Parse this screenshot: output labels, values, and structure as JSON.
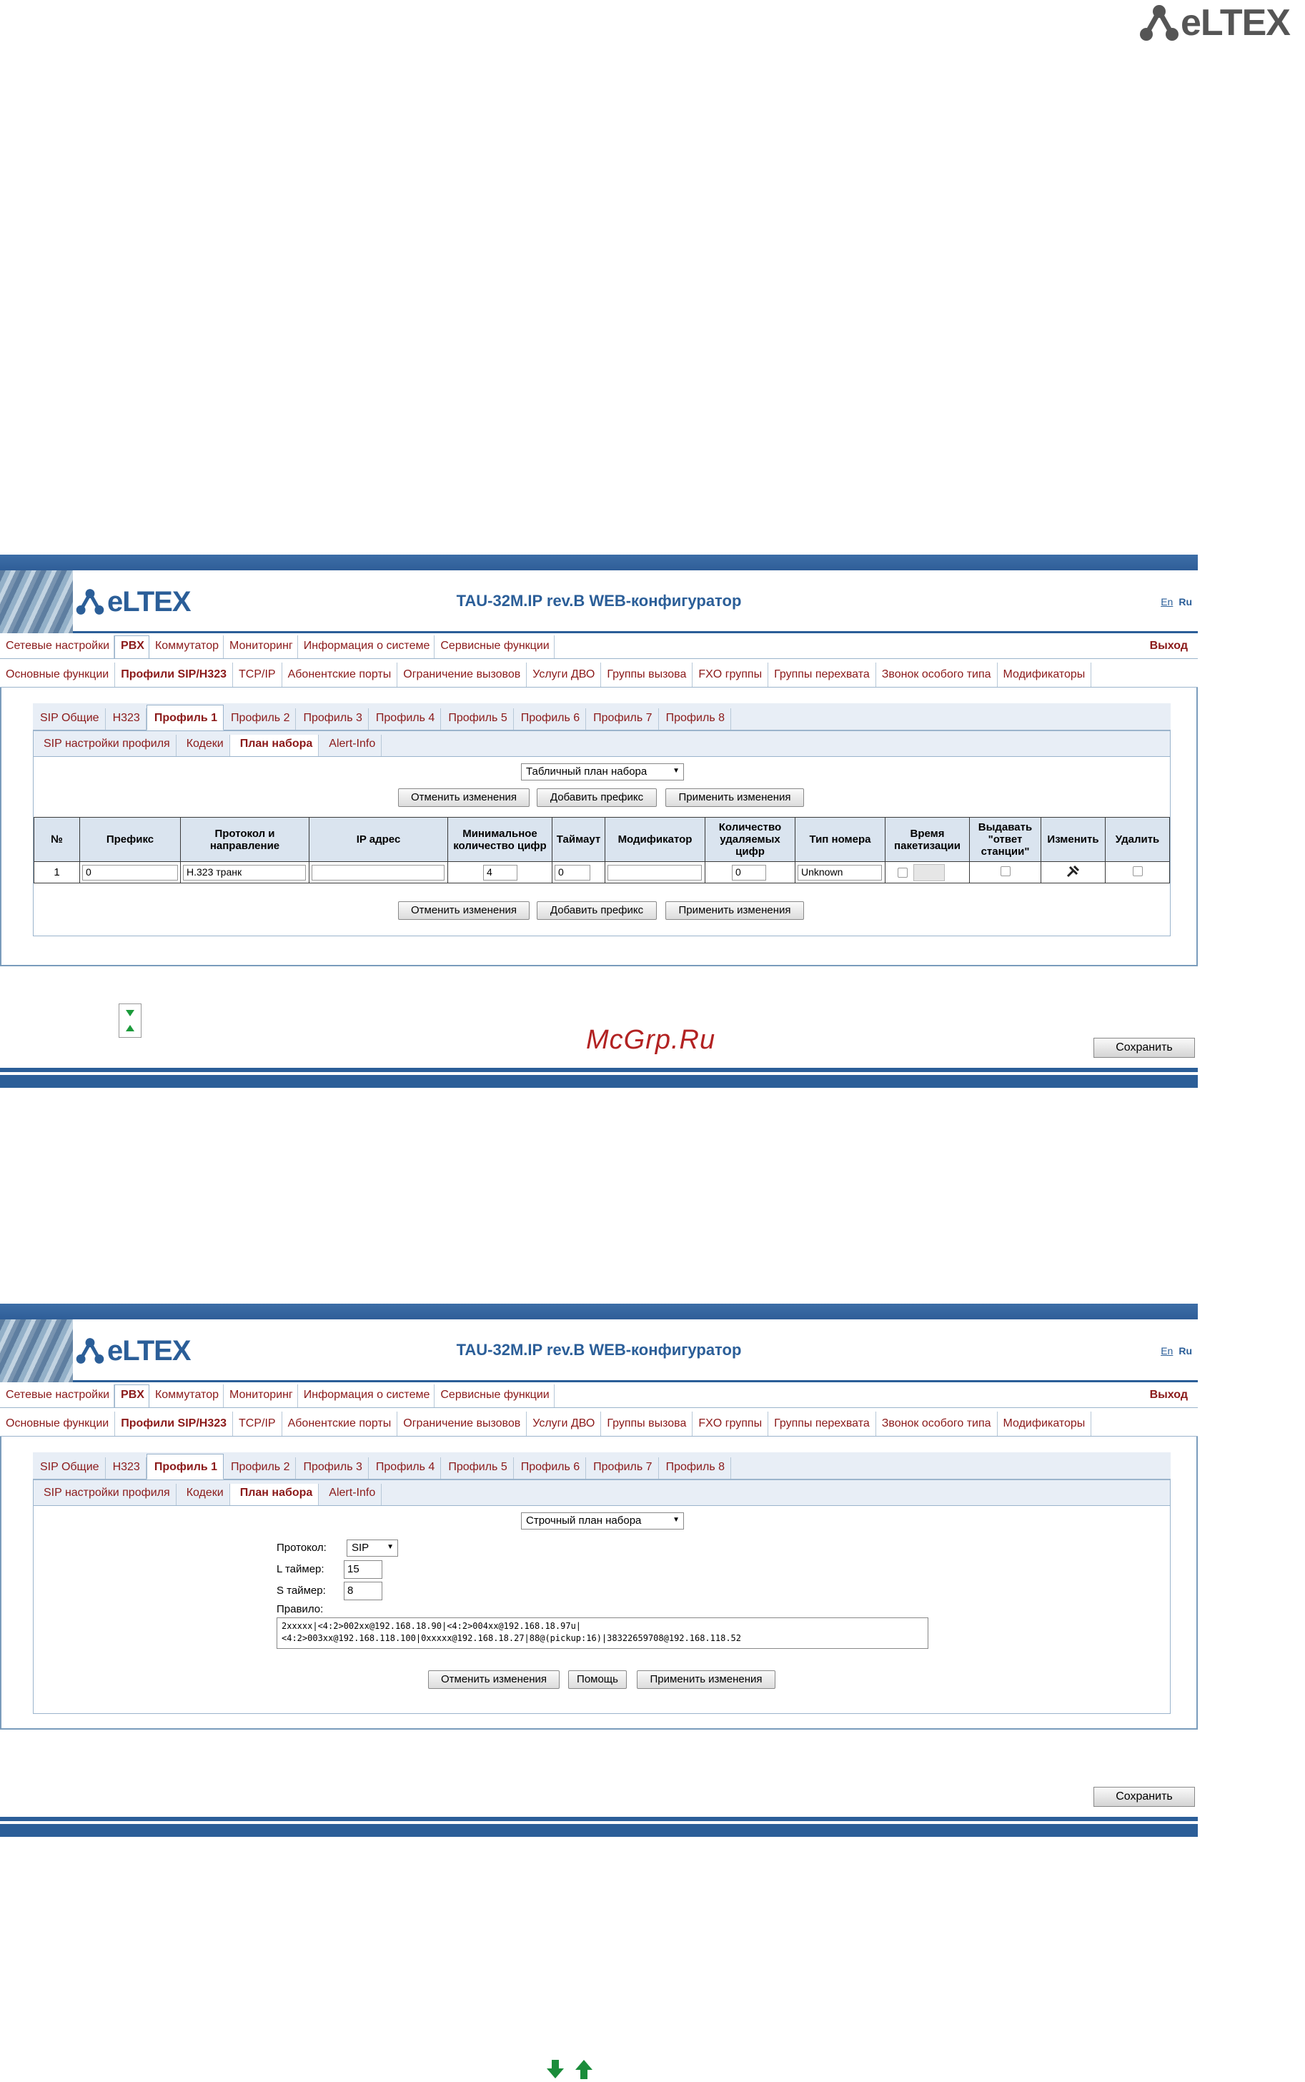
{
  "brand": {
    "logo_text": "eLTEX"
  },
  "screens": [
    {
      "header": {
        "title": "TAU-32M.IP rev.B WEB-конфигуратор",
        "lang_en": "En",
        "lang_ru": "Ru"
      },
      "menu1": [
        "Сетевые настройки",
        "PBX",
        "Коммутатор",
        "Мониторинг",
        "Информация о системе",
        "Сервисные функции"
      ],
      "exit": "Выход",
      "menu2": [
        "Основные функции",
        "Профили SIP/H323",
        "TCP/IP",
        "Абонентские порты",
        "Ограничение вызовов",
        "Услуги ДВО",
        "Группы вызова",
        "FXO группы",
        "Группы перехвата",
        "Звонок особого типа",
        "Модификаторы"
      ],
      "tabs3": [
        "SIP Общие",
        "H323",
        "Профиль 1",
        "Профиль 2",
        "Профиль 3",
        "Профиль 4",
        "Профиль 5",
        "Профиль 6",
        "Профиль 7",
        "Профиль 8"
      ],
      "tabs4": [
        "SIP настройки профиля",
        "Кодеки",
        "План набора",
        "Alert-Info"
      ],
      "plan_select": "Табличный план набора",
      "buttons": {
        "cancel": "Отменить изменения",
        "add": "Добавить префикс",
        "apply": "Применить изменения"
      },
      "table": {
        "headers": [
          "№",
          "Префикс",
          "Протокол и направление",
          "IP адрес",
          "Минимальное количество цифр",
          "Таймаут",
          "Модификатор",
          "Количество удаляемых цифр",
          "Тип номера",
          "Время пакетизации",
          "Выдавать \"ответ станции\"",
          "Изменить",
          "Удалить"
        ],
        "row": {
          "num": "1",
          "prefix": "0",
          "protocol": "H.323 транк",
          "ip": "",
          "min_digits": "4",
          "timeout": "0",
          "modifier": "",
          "delete_digits": "0",
          "number_type": "Unknown"
        }
      },
      "save": "Сохранить"
    },
    {
      "header": {
        "title": "TAU-32M.IP rev.B WEB-конфигуратор",
        "lang_en": "En",
        "lang_ru": "Ru"
      },
      "plan_select": "Строчный план набора",
      "form": {
        "protocol_label": "Протокол:",
        "protocol_value": "SIP",
        "l_timer_label": "L таймер:",
        "l_timer_value": "15",
        "s_timer_label": "S таймер:",
        "s_timer_value": "8",
        "rule_label": "Правило:",
        "rule_line1": "2xxxxx|<4:2>002xx@192.168.18.90|<4:2>004xx@192.168.18.97u|",
        "rule_line2": "<4:2>003xx@192.168.118.100|0xxxxx@192.168.18.27|88@(pickup:16)|38322659708@192.168.118.52"
      },
      "buttons": {
        "cancel": "Отменить изменения",
        "help": "Помощь",
        "apply": "Применить изменения"
      },
      "save": "Сохранить"
    }
  ],
  "watermark": "McGrp.Ru",
  "icons": [
    "eltex-logo-icon",
    "scroll-arrows-icon",
    "edit-tool-icon",
    "nav-down-arrow-icon",
    "nav-up-arrow-icon"
  ]
}
